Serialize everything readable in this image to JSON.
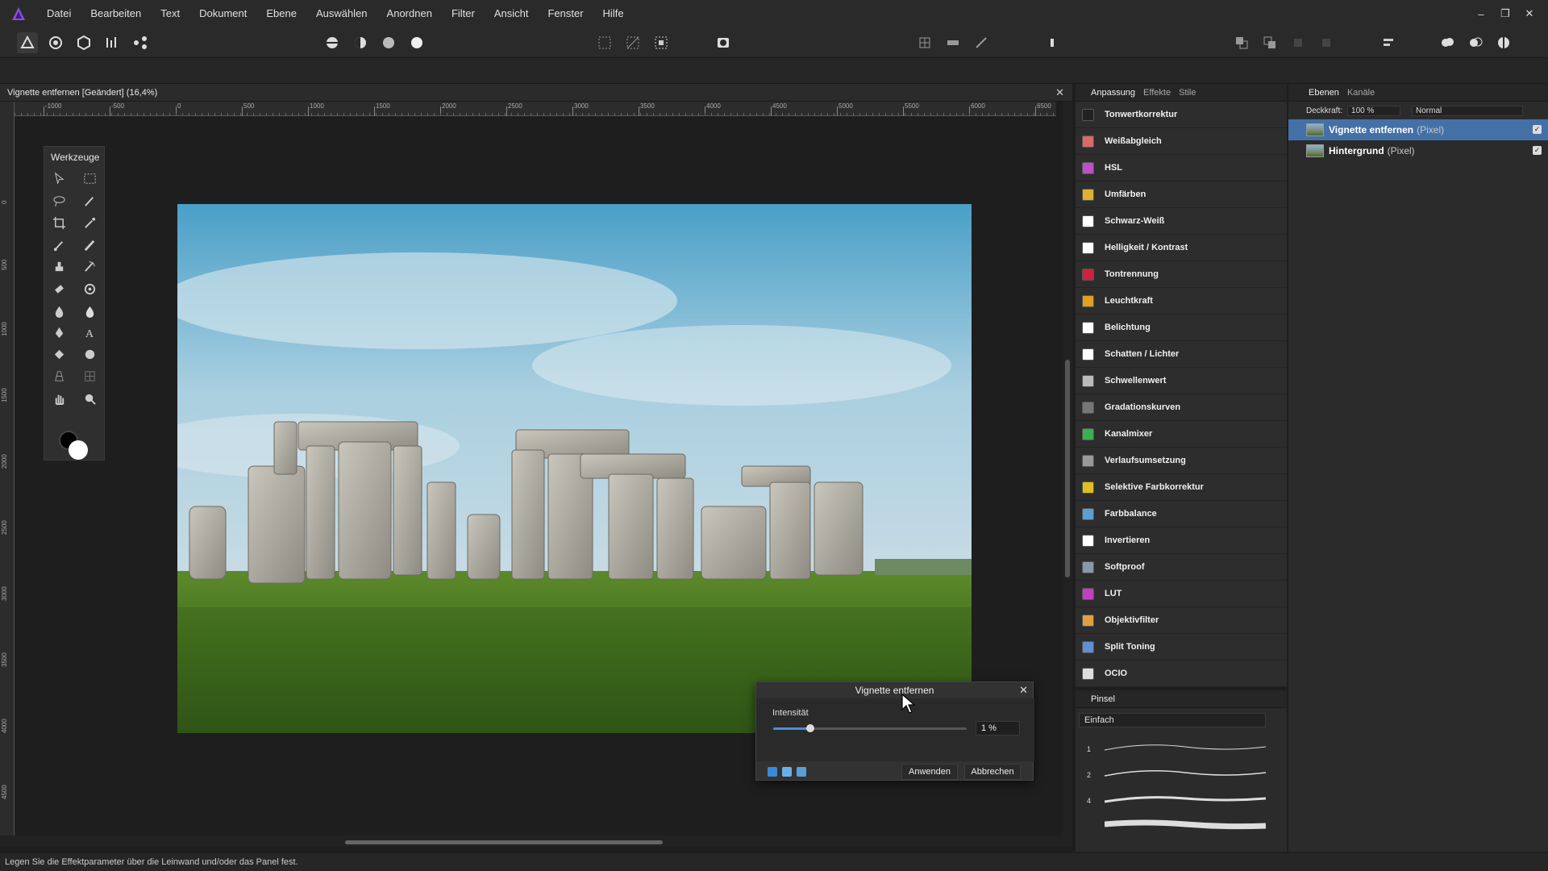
{
  "app": {
    "logo": "affinity-photo-logo"
  },
  "menu": [
    "Datei",
    "Bearbeiten",
    "Text",
    "Dokument",
    "Ebene",
    "Auswählen",
    "Anordnen",
    "Filter",
    "Ansicht",
    "Fenster",
    "Hilfe"
  ],
  "window_controls": {
    "minimize": "–",
    "restore": "❐",
    "close": "✕"
  },
  "document": {
    "title": "Vignette entfernen [Geändert] (16,4%)",
    "close": "✕"
  },
  "ruler": {
    "corner_unit": "px",
    "top_labels": [
      "-1000",
      "-500",
      "0",
      "500",
      "1000",
      "1500",
      "2000",
      "2500",
      "3000",
      "3500",
      "4000",
      "4500",
      "5000",
      "5500",
      "6000",
      "6500"
    ],
    "left_labels": [
      "0",
      "500",
      "1000",
      "1500",
      "2000",
      "2500",
      "3000",
      "3500",
      "4000",
      "4500"
    ]
  },
  "tools_panel": {
    "title": "Werkzeuge"
  },
  "adjustments": {
    "tabs": [
      "Anpassung",
      "Effekte",
      "Stile"
    ],
    "items": [
      {
        "label": "Tonwertkorrektur",
        "color": "#222222"
      },
      {
        "label": "Weißabgleich",
        "color": "#d86a6a"
      },
      {
        "label": "HSL",
        "color": "#c050c8"
      },
      {
        "label": "Umfärben",
        "color": "#e0b030"
      },
      {
        "label": "Schwarz-Weiß",
        "color": "#ffffff"
      },
      {
        "label": "Helligkeit / Kontrast",
        "color": "#ffffff"
      },
      {
        "label": "Tontrennung",
        "color": "#d02040"
      },
      {
        "label": "Leuchtkraft",
        "color": "#e0a020"
      },
      {
        "label": "Belichtung",
        "color": "#ffffff"
      },
      {
        "label": "Schatten / Lichter",
        "color": "#ffffff"
      },
      {
        "label": "Schwellenwert",
        "color": "#bbbbbb"
      },
      {
        "label": "Gradationskurven",
        "color": "#777777"
      },
      {
        "label": "Kanalmixer",
        "color": "#3cb050"
      },
      {
        "label": "Verlaufsumsetzung",
        "color": "#999999"
      },
      {
        "label": "Selektive Farbkorrektur",
        "color": "#e0c020"
      },
      {
        "label": "Farbbalance",
        "color": "#5aa0d0"
      },
      {
        "label": "Invertieren",
        "color": "#ffffff"
      },
      {
        "label": "Softproof",
        "color": "#8899aa"
      },
      {
        "label": "LUT",
        "color": "#c040c0"
      },
      {
        "label": "Objektivfilter",
        "color": "#e0a040"
      },
      {
        "label": "Split Toning",
        "color": "#6090d0"
      },
      {
        "label": "OCIO",
        "color": "#dddddd"
      }
    ]
  },
  "brush_panel": {
    "title": "Pinsel",
    "category": "Einfach",
    "sizes": [
      "1",
      "2",
      "4"
    ]
  },
  "layers": {
    "tabs": [
      "Ebenen",
      "Kanäle"
    ],
    "opacity_label": "Deckkraft:",
    "opacity_value": "100 %",
    "blend_mode": "Normal",
    "items": [
      {
        "name": "Vignette entfernen",
        "type": "(Pixel)",
        "selected": true
      },
      {
        "name": "Hintergrund",
        "type": "(Pixel)",
        "selected": false
      }
    ]
  },
  "dialog": {
    "title": "Vignette entfernen",
    "close": "✕",
    "slider_label": "Intensität",
    "slider_value": "1 %",
    "slider_fraction": 0.19,
    "apply": "Anwenden",
    "cancel": "Abbrechen"
  },
  "status": "Legen Sie die Effektparameter über die Leinwand und/oder das Panel fest."
}
